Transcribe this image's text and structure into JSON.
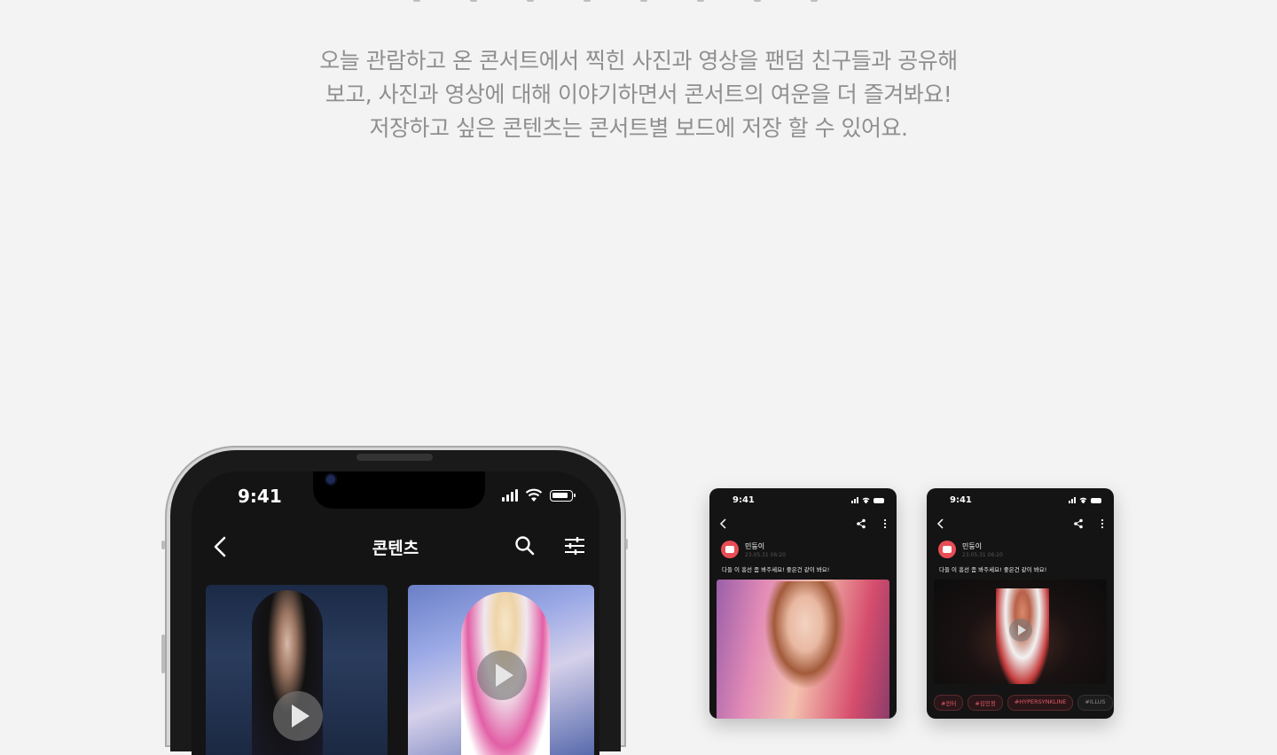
{
  "description": {
    "lines": [
      "오늘 관람하고 온 콘서트에서 찍힌 사진과 영상을 팬덤 친구들과 공유해",
      "보고, 사진과 영상에 대해 이야기하면서 콘서트의 여운을 더 즐겨봐요!",
      "저장하고 싶은 콘텐츠는 콘서트별 보드에 저장 할 수 있어요."
    ]
  },
  "main_phone": {
    "time": "9:41",
    "title": "콘텐츠",
    "icons": [
      "back-icon",
      "search-icon",
      "filter-icon",
      "play-icon"
    ]
  },
  "mini_left": {
    "time": "9:41",
    "author": "민둥이",
    "date": "23.05.31 06:20",
    "text": "다들 이 흥선 좀 봐주세요! 좋은건 같이 봐요!"
  },
  "mini_right": {
    "time": "9:41",
    "author": "민둥이",
    "date": "23.05.31 06:20",
    "text": "다들 이 흥선 좀 봐주세요! 좋은건 같이 봐요!",
    "tags": [
      "#윈터",
      "#김민정",
      "#HYPERSYNKLINE",
      "#ILLUS"
    ]
  },
  "colors": {
    "background": "#f3f3f3",
    "accent": "#e84d55",
    "text": "#8f8f8f"
  }
}
